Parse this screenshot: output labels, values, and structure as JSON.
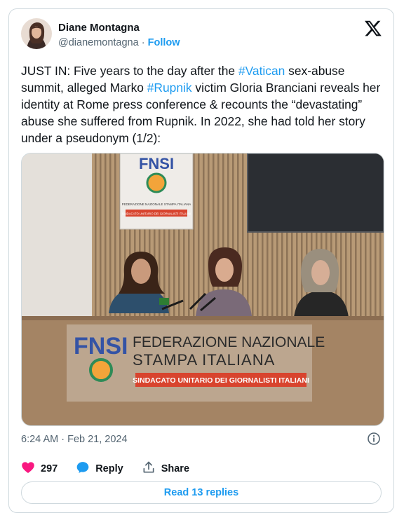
{
  "author": {
    "name": "Diane Montagna",
    "handle": "@dianemontagna",
    "separator": "·",
    "follow_label": "Follow"
  },
  "tweet": {
    "text_parts": [
      {
        "t": "JUST IN: Five years to the day after the ",
        "tag": false
      },
      {
        "t": "#Vatican",
        "tag": true
      },
      {
        "t": " sex-abuse summit, alleged Marko ",
        "tag": false
      },
      {
        "t": "#Rupnik",
        "tag": true
      },
      {
        "t": " victim Gloria Branciani reveals her identity at Rome press conference & recounts the “devastating” abuse she suffered from Rupnik.  In 2022, she had told her story under a pseudonym (1/2):",
        "tag": false
      }
    ]
  },
  "media": {
    "poster_top_text": "FNSI",
    "poster_line1": "FEDERAZIONE NAZIONALE STAMPA ITALIANA",
    "poster_line2": "SINDACATO UNITARIO DEI GIORNALISTI ITALIANI",
    "desk_logo": "FNSI",
    "desk_line1": "FEDERAZIONE NAZIONALE",
    "desk_line2": "STAMPA ITALIANA",
    "desk_banner": "SINDACATO UNITARIO DEI GIORNALISTI ITALIANI"
  },
  "meta": {
    "timestamp": "6:24 AM · Feb 21, 2024"
  },
  "actions": {
    "likes_count": "297",
    "reply_label": "Reply",
    "share_label": "Share"
  },
  "read_replies_label": "Read 13 replies",
  "colors": {
    "accent": "#1d9bf0",
    "like": "#f91880",
    "muted": "#536471",
    "border": "#cfd9de"
  },
  "icons": [
    "x-logo-icon",
    "info-icon",
    "heart-icon",
    "reply-bubble-icon",
    "share-icon"
  ]
}
